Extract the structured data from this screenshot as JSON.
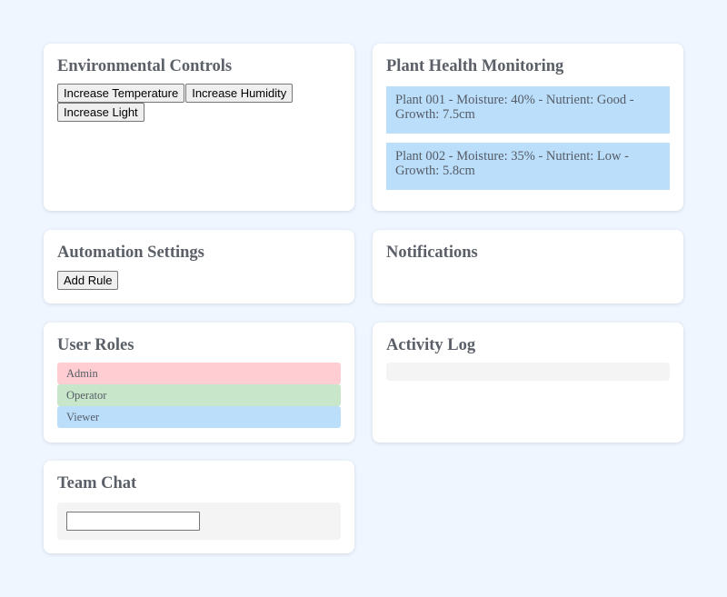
{
  "env_controls": {
    "title": "Environmental Controls",
    "buttons": [
      "Increase Temperature",
      "Increase Humidity",
      "Increase Light"
    ]
  },
  "plant_health": {
    "title": "Plant Health Monitoring",
    "plants": [
      "Plant 001 - Moisture: 40% - Nutrient: Good - Growth: 7.5cm",
      "Plant 002 - Moisture: 35% - Nutrient: Low - Growth: 5.8cm"
    ]
  },
  "automation": {
    "title": "Automation Settings",
    "add_rule_label": "Add Rule"
  },
  "notifications": {
    "title": "Notifications"
  },
  "user_roles": {
    "title": "User Roles",
    "roles": [
      {
        "label": "Admin",
        "color": "#ffcdd2"
      },
      {
        "label": "Operator",
        "color": "#c8e6c9"
      },
      {
        "label": "Viewer",
        "color": "#bbdefb"
      }
    ]
  },
  "activity_log": {
    "title": "Activity Log"
  },
  "team_chat": {
    "title": "Team Chat",
    "input_value": ""
  },
  "colors": {
    "page_bg": "#eff6ff",
    "panel_bg": "#ffffff",
    "plant_bg": "#bbdefb",
    "muted_box": "#f4f4f4"
  }
}
